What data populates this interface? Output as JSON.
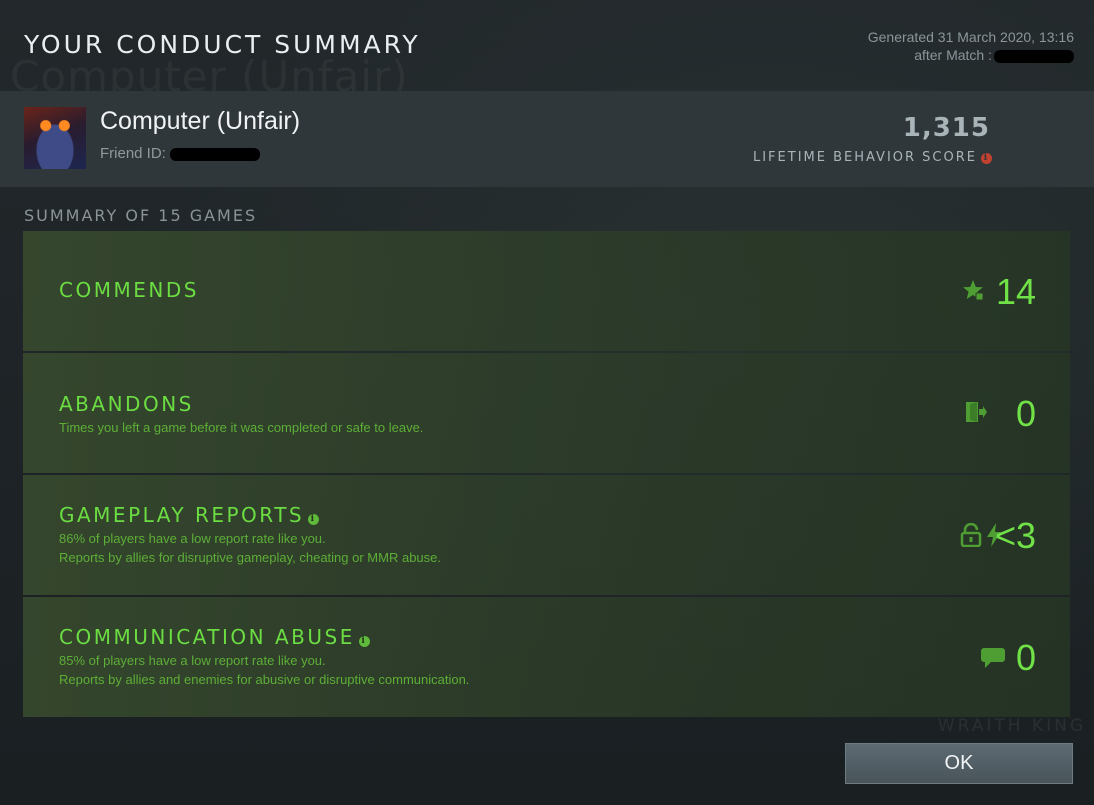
{
  "header": {
    "title": "YOUR CONDUCT SUMMARY",
    "generated_line": "Generated 31 March 2020, 13:16",
    "after_match_label": "after Match :"
  },
  "profile": {
    "name": "Computer (Unfair)",
    "friend_id_label": "Friend ID:",
    "behavior_score": "1,315",
    "behavior_score_label": "LIFETIME BEHAVIOR SCORE"
  },
  "summary": {
    "title": "SUMMARY OF 15 GAMES",
    "rows": [
      {
        "label": "COMMENDS",
        "desc1": "",
        "desc2": "",
        "value": "14",
        "icon": "star-thumb-icon"
      },
      {
        "label": "ABANDONS",
        "desc1": "Times you left a game before it was completed or safe to leave.",
        "desc2": "",
        "value": "0",
        "icon": "exit-door-icon"
      },
      {
        "label": "GAMEPLAY REPORTS",
        "desc1": "86% of players have a low report rate like you.",
        "desc2": "Reports by allies for disruptive gameplay, cheating or MMR abuse.",
        "value": "<3",
        "icon": "lock-lightning-icon"
      },
      {
        "label": "COMMUNICATION ABUSE",
        "desc1": "85% of players have a low report rate like you.",
        "desc2": "Reports by allies and enemies for abusive or disruptive communication.",
        "value": "0",
        "icon": "speech-bubble-icon"
      }
    ]
  },
  "background": {
    "ghost_title": "Computer (Unfair)",
    "ghost_hero": "WRAITH KING"
  },
  "footer": {
    "ok_label": "OK"
  },
  "colors": {
    "accent_green": "#6bdc42",
    "alert_red": "#c2412f"
  }
}
